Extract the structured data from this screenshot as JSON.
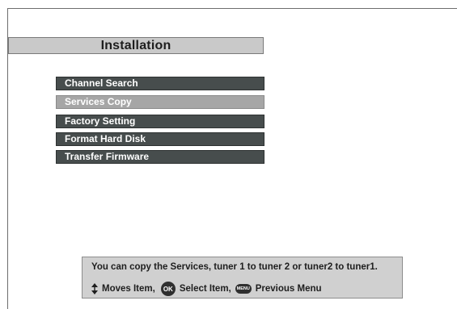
{
  "header": {
    "title": "Installation"
  },
  "menu": {
    "items": [
      {
        "label": "Channel Search"
      },
      {
        "label": "Services Copy"
      },
      {
        "label": "Factory Setting"
      },
      {
        "label": "Format Hard Disk"
      },
      {
        "label": "Transfer Firmware"
      }
    ],
    "selected_label": "Services Copy"
  },
  "help": {
    "text": "You can copy the Services, tuner 1 to tuner 2 or tuner2 to tuner1.",
    "moves_label": "Moves  Item,",
    "ok_icon_text": "OK",
    "select_label": "Select Item,",
    "menu_icon_text": "MENU",
    "previous_label": "Previous Menu"
  },
  "colors": {
    "item_bg": "#474d4d",
    "item_selected_bg": "#a6a6a6",
    "title_bar_bg": "#c9c9c9",
    "help_bg": "#d0d0d0"
  }
}
